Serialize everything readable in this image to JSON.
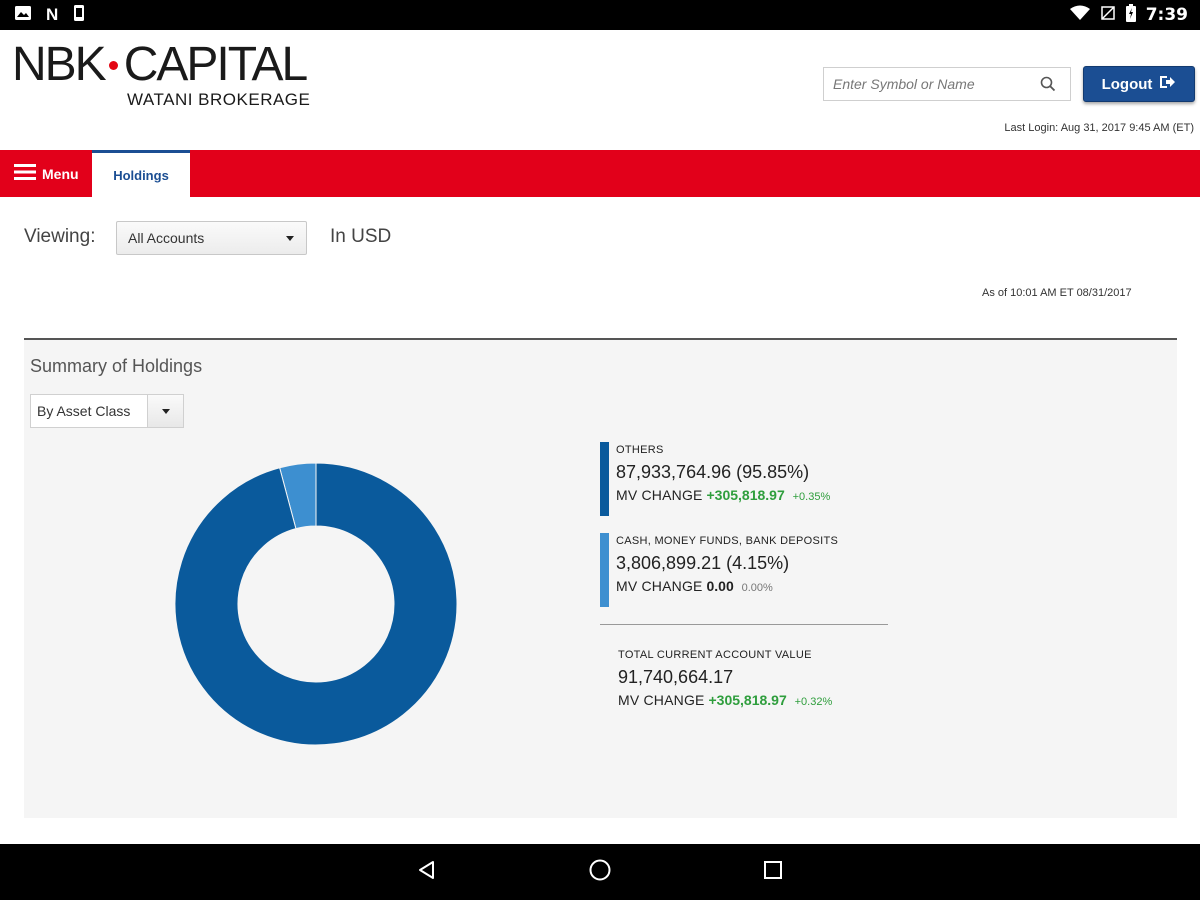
{
  "status_bar": {
    "time": "7:39",
    "notif_letter": "N"
  },
  "brand": {
    "name_left": "NBK",
    "name_right": "CAPITAL",
    "sub": "WATANI BROKERAGE"
  },
  "search": {
    "placeholder": "Enter Symbol or Name"
  },
  "logout": {
    "label": "Logout"
  },
  "last_login": "Last Login: Aug 31, 2017 9:45 AM (ET)",
  "nav": {
    "menu_label": "Menu",
    "active_tab": "Holdings"
  },
  "viewing": {
    "label": "Viewing:",
    "selected": "All Accounts",
    "currency": "In USD"
  },
  "as_of": "As of 10:01 AM ET 08/31/2017",
  "summary": {
    "title": "Summary of Holdings",
    "group_by": "By Asset Class",
    "items": [
      {
        "name": "OTHERS",
        "value": "87,933,764.96 (95.85%)",
        "mv_label": "MV CHANGE",
        "mv_change": "+305,818.97",
        "mv_pct": "+0.35%",
        "color": "#0a5a9c"
      },
      {
        "name": "CASH, MONEY FUNDS, BANK DEPOSITS",
        "value": "3,806,899.21 (4.15%)",
        "mv_label": "MV CHANGE",
        "mv_change": "0.00",
        "mv_pct": "0.00%",
        "color": "#3d8fd0"
      }
    ],
    "total": {
      "name": "TOTAL CURRENT ACCOUNT VALUE",
      "value": "91,740,664.17",
      "mv_label": "MV CHANGE",
      "mv_change": "+305,818.97",
      "mv_pct": "+0.32%"
    }
  },
  "chart_data": {
    "type": "pie",
    "categories": [
      "OTHERS",
      "CASH, MONEY FUNDS, BANK DEPOSITS"
    ],
    "values": [
      95.85,
      4.15
    ],
    "colors": [
      "#0a5a9c",
      "#3d8fd0"
    ]
  }
}
